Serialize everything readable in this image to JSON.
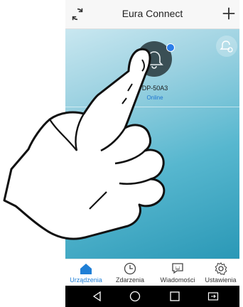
{
  "header": {
    "title": "Eura Connect",
    "refresh_icon": "refresh-icon",
    "add_icon": "plus-icon"
  },
  "device": {
    "name": "DP-50A3",
    "status": "Online",
    "icon": "bell-icon",
    "notification_color": "#2b7de9"
  },
  "alarm_button": {
    "icon": "bell-settings-icon"
  },
  "bottom_nav": {
    "active_color": "#1f7fd6",
    "tabs": [
      {
        "label": "Urządzenia",
        "icon": "home-icon",
        "active": true
      },
      {
        "label": "Zdarzenia",
        "icon": "clock-icon",
        "active": false
      },
      {
        "label": "Wiadomości",
        "icon": "message-icon",
        "active": false
      },
      {
        "label": "Ustawienia",
        "icon": "gear-icon",
        "active": false
      }
    ]
  },
  "system_nav": {
    "buttons": [
      "back-icon",
      "home-circle-icon",
      "recents-icon",
      "screen-mirror-icon"
    ]
  }
}
